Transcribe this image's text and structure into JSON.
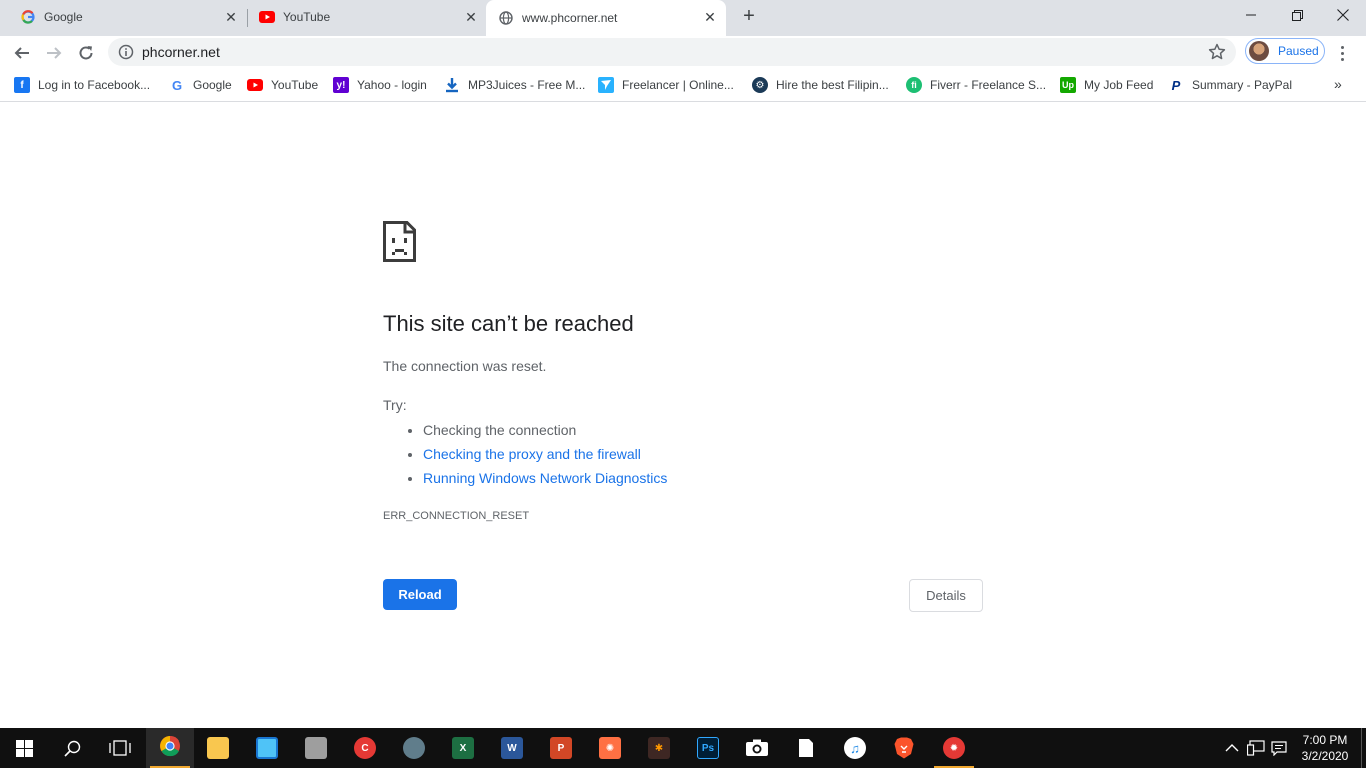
{
  "tabs": [
    {
      "title": "Google",
      "icon": "google-g-icon",
      "active": false
    },
    {
      "title": "YouTube",
      "icon": "youtube-icon",
      "active": false
    },
    {
      "title": "www.phcorner.net",
      "icon": "globe-icon",
      "active": true
    }
  ],
  "toolbar": {
    "url": "phcorner.net",
    "profile_label": "Paused"
  },
  "bookmarks": [
    {
      "label": "Log in to Facebook...",
      "icon": "facebook-icon",
      "color": "#1877f2"
    },
    {
      "label": "Google",
      "icon": "google-g-icon",
      "color": "#4285f4"
    },
    {
      "label": "YouTube",
      "icon": "youtube-icon",
      "color": "#ff0000"
    },
    {
      "label": "Yahoo - login",
      "icon": "yahoo-icon",
      "color": "#6001d2"
    },
    {
      "label": "MP3Juices - Free M...",
      "icon": "download-icon",
      "color": "#1565c0"
    },
    {
      "label": "Freelancer | Online...",
      "icon": "freelancer-icon",
      "color": "#29b2fe"
    },
    {
      "label": "Hire the best Filipin...",
      "icon": "onlinejobs-icon",
      "color": "#1b3a57"
    },
    {
      "label": "Fiverr - Freelance S...",
      "icon": "fiverr-icon",
      "color": "#1dbf73"
    },
    {
      "label": "My Job Feed",
      "icon": "upwork-icon",
      "color": "#14a800"
    },
    {
      "label": "Summary - PayPal",
      "icon": "paypal-icon",
      "color": "#003087"
    }
  ],
  "error": {
    "title": "This site can’t be reached",
    "description": "The connection was reset.",
    "try_label": "Try:",
    "suggestions": [
      "Checking the connection",
      "Checking the proxy and the firewall",
      "Running Windows Network Diagnostics"
    ],
    "code": "ERR_CONNECTION_RESET",
    "reload_label": "Reload",
    "details_label": "Details"
  },
  "taskbar": {
    "time": "7:00 PM",
    "date": "3/2/2020"
  },
  "colors": {
    "accent": "#1a73e8",
    "tabstrip": "#dee1e6",
    "taskbar": "#101010"
  }
}
